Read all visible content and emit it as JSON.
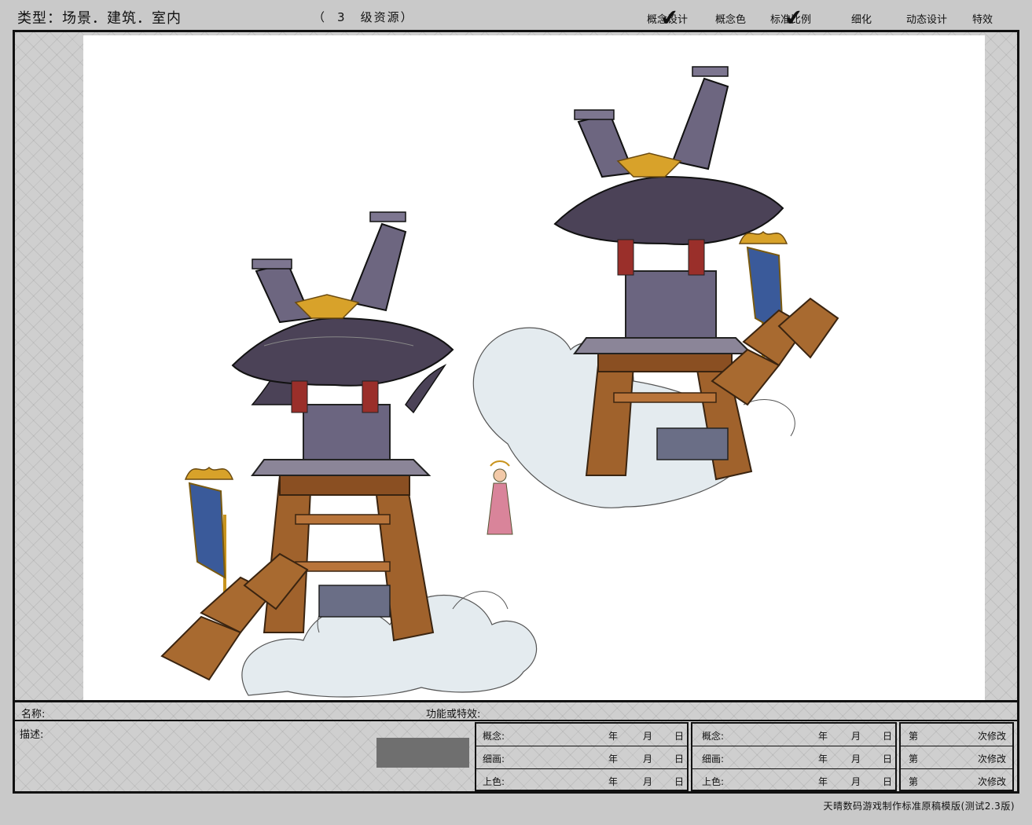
{
  "header": {
    "type_label": "类型：场景．建筑．室内",
    "level_open": "（",
    "level_num": "3",
    "level_text": "级资源）",
    "stages": [
      "概念设计",
      "概念色",
      "标准比例",
      "细化",
      "动态设计",
      "特效"
    ],
    "checks": [
      "✔",
      "✔"
    ]
  },
  "info": {
    "name_label": "名称:",
    "function_label": "功能或特效:",
    "desc_label": "描述:",
    "table_rows": [
      "概念:",
      "细画:",
      "上色:"
    ],
    "date_units": [
      "年",
      "月",
      "日"
    ],
    "revision_prefix": "第",
    "revision_suffix": "次修改"
  },
  "footer": {
    "text": "天晴数码游戏制作标准原稿模版(测试2.3版)"
  },
  "colors": {
    "roof": "#4b4257",
    "wood": "#a0622c",
    "gold": "#d8a22a",
    "banner": "#3a5a9a",
    "cloud": "#dde6ec"
  }
}
